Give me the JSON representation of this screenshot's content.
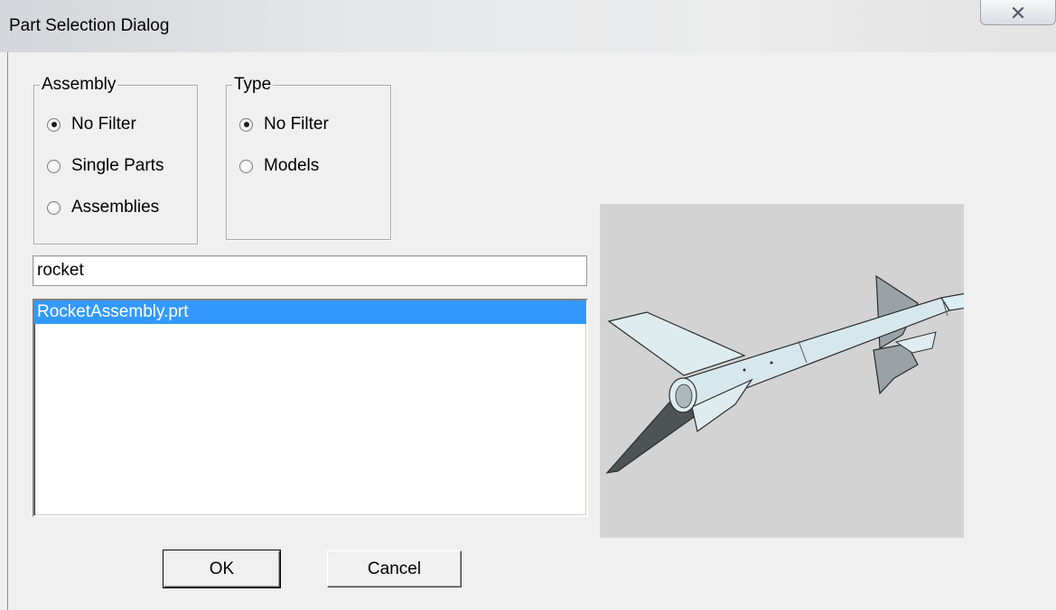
{
  "window": {
    "title": "Part Selection Dialog",
    "close_glyph": "✕"
  },
  "assembly_group": {
    "label": "Assembly",
    "options": [
      "No Filter",
      "Single Parts",
      "Assemblies"
    ],
    "selected": "No Filter"
  },
  "type_group": {
    "label": "Type",
    "options": [
      "No Filter",
      "Models"
    ],
    "selected": "No Filter"
  },
  "search": {
    "value": "rocket"
  },
  "parts_list": {
    "items": [
      "RocketAssembly.prt"
    ],
    "selected": "RocketAssembly.prt"
  },
  "buttons": {
    "ok": "OK",
    "cancel": "Cancel"
  },
  "preview": {
    "icon": "rocket-model-icon",
    "background": "#d3d3d3",
    "model_color": "#d7e8ec"
  },
  "colors": {
    "selection": "#3399ff",
    "dialog_bg": "#f0f0f0"
  }
}
